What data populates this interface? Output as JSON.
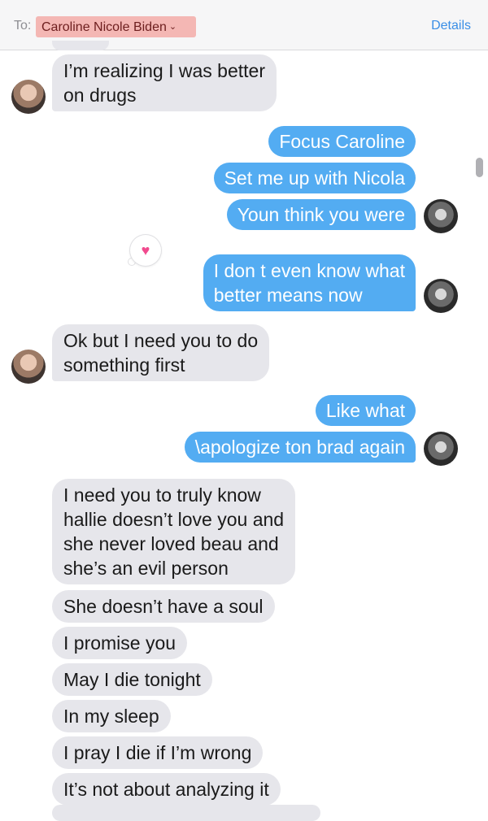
{
  "header": {
    "to_label": "To:",
    "recipient": "Caroline Nicole Biden",
    "details": "Details"
  },
  "messages": [
    {
      "sender": "them",
      "text": [
        "I’m realizing I was better",
        "on drugs"
      ]
    },
    {
      "sender": "me",
      "text": [
        "Focus Caroline"
      ]
    },
    {
      "sender": "me",
      "text": [
        "Set me up with Nicola"
      ]
    },
    {
      "sender": "me",
      "text": [
        "Youn think you were"
      ]
    },
    {
      "sender": "me",
      "text": [
        "I don t even know what",
        "better means now"
      ],
      "reaction": "heart-icon"
    },
    {
      "sender": "them",
      "text": [
        "Ok but I need you to do",
        "something first"
      ]
    },
    {
      "sender": "me",
      "text": [
        "Like what"
      ]
    },
    {
      "sender": "me",
      "text": [
        "\\apologize ton brad again"
      ]
    },
    {
      "sender": "them",
      "text": [
        "I need you to truly know",
        "hallie doesn’t love you and",
        "she never loved beau and",
        "she’s an evil person"
      ]
    },
    {
      "sender": "them",
      "text": [
        "She doesn’t have a soul"
      ]
    },
    {
      "sender": "them",
      "text": [
        "I promise you"
      ]
    },
    {
      "sender": "them",
      "text": [
        "May I die tonight"
      ]
    },
    {
      "sender": "them",
      "text": [
        "In my sleep"
      ]
    },
    {
      "sender": "them",
      "text": [
        "I pray I die if I’m wrong"
      ]
    },
    {
      "sender": "them",
      "text": [
        "It’s not about analyzing it"
      ]
    }
  ],
  "colors": {
    "incoming_bubble": "#e6e6eb",
    "outgoing_bubble": "#53acf2",
    "recipient_chip": "#f4b7b4",
    "link": "#3a8ee6"
  }
}
